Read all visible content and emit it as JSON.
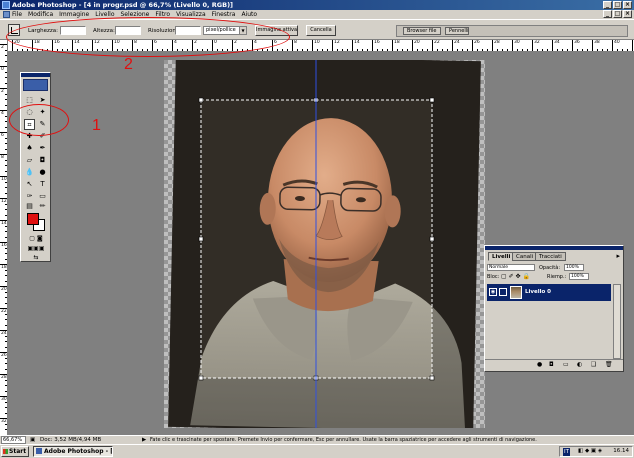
{
  "window": {
    "title": "Adobe Photoshop - [4 in progr.psd @ 66,7% (Livello 0, RGB)]",
    "controls": [
      "_",
      "□",
      "×"
    ]
  },
  "menu": [
    "File",
    "Modifica",
    "Immagine",
    "Livello",
    "Selezione",
    "Filtro",
    "Visualizza",
    "Finestra",
    "Aiuto"
  ],
  "options_bar": {
    "width_label": "Larghezza:",
    "height_label": "Altezza:",
    "resolution_label": "Risoluzione:",
    "resolution_unit": "pixel/pollice",
    "front_image_button": "Immagine attiva",
    "clear_button": "Cancella",
    "palette_tabs": [
      "Browser file",
      "Pennelli"
    ]
  },
  "annotations": {
    "label_1": "1",
    "label_2": "2",
    "color": "#e01010"
  },
  "rulers": {
    "horizontal_labels": [
      "20",
      "18",
      "16",
      "14",
      "12",
      "10",
      "8",
      "6",
      "4",
      "2",
      "0",
      "2",
      "4",
      "6",
      "8",
      "10",
      "12",
      "14",
      "16",
      "18",
      "20",
      "22",
      "24",
      "26",
      "28",
      "30",
      "32",
      "34",
      "36",
      "38",
      "40",
      "42",
      "44"
    ],
    "vertical_labels": [
      "2",
      "0",
      "2",
      "4",
      "6",
      "8",
      "10",
      "12",
      "14",
      "16",
      "18",
      "20",
      "22",
      "24",
      "26",
      "28",
      "30",
      "32"
    ]
  },
  "toolbox": {
    "selected_tool": "crop-tool",
    "foreground_color": "#e01010",
    "background_color": "#ffffff"
  },
  "layers_panel": {
    "tabs": [
      "Livelli",
      "Canali",
      "Tracciati"
    ],
    "blend_mode": "Normale",
    "opacity_label": "Opacità:",
    "opacity_value": "100%",
    "lock_label": "Bloc:",
    "fill_label": "Riemp.:",
    "fill_value": "100%",
    "layer_name": "Livello 0"
  },
  "status_bar": {
    "zoom": "66,67%",
    "doc_size": "Doc: 3,52 MB/4,94 MB",
    "hint": "Fate clic e trascinate per spostare. Premete Invio per confermare, Esc per annullare. Usate la barra spaziatrice per accedere agli strumenti di navigazione."
  },
  "taskbar": {
    "start_label": "Start",
    "task_label": "Adobe Photoshop - [4...",
    "tray_lang": "IT",
    "clock": "16.14"
  }
}
